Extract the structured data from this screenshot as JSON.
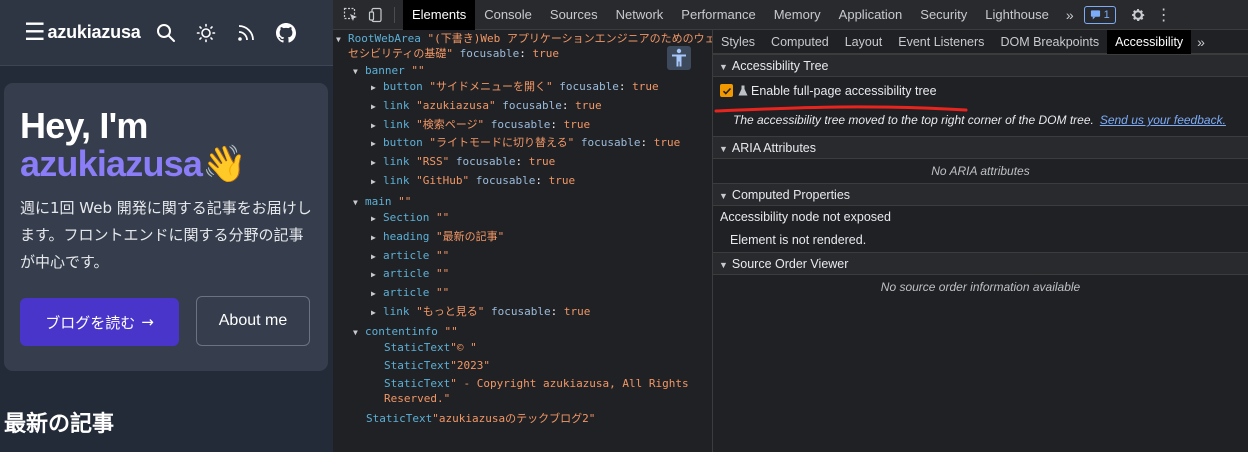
{
  "site": {
    "header": {
      "menu_glyph": "☰",
      "name": "azukiazusa",
      "icons": [
        "search-icon",
        "sun-icon",
        "rss-icon",
        "github-icon"
      ]
    },
    "hero": {
      "title_line1": "Hey, I'm",
      "title_name": "azukiazusa",
      "title_emoji": "👋",
      "description": "週に1回 Web 開発に関する記事をお届けします。フロントエンドに関する分野の記事が中心です。",
      "primary_button": "ブログを読む",
      "primary_button_arrow": "→",
      "secondary_button": "About me"
    },
    "latest_heading": "最新の記事"
  },
  "devtools": {
    "main_tabs": [
      "Elements",
      "Console",
      "Sources",
      "Network",
      "Performance",
      "Memory",
      "Application",
      "Security",
      "Lighthouse"
    ],
    "active_main_tab": "Elements",
    "more_tabs_glyph": "»",
    "issues_count": "1",
    "menu_glyph": "⋮",
    "tree": {
      "root": {
        "role": "RootWebArea",
        "name_line1": "\"(下書き)Web アプリケーションエンジニアのためのウェブアク",
        "name_line2": "セシビリティの基礎\"",
        "attr": "focusable",
        "value": "true"
      },
      "banner": {
        "role": "banner",
        "name": "\"\""
      },
      "banner_children": [
        {
          "role": "button",
          "name": "\"サイドメニューを開く\"",
          "attr": "focusable",
          "value": "true"
        },
        {
          "role": "link",
          "name": "\"azukiazusa\"",
          "attr": "focusable",
          "value": "true"
        },
        {
          "role": "link",
          "name": "\"検索ページ\"",
          "attr": "focusable",
          "value": "true"
        },
        {
          "role": "button",
          "name": "\"ライトモードに切り替える\"",
          "attr": "focusable",
          "value": "true"
        },
        {
          "role": "link",
          "name": "\"RSS\"",
          "attr": "focusable",
          "value": "true"
        },
        {
          "role": "link",
          "name": "\"GitHub\"",
          "attr": "focusable",
          "value": "true"
        }
      ],
      "main": {
        "role": "main",
        "name": "\"\""
      },
      "main_children": [
        {
          "role": "Section",
          "name": "\"\"",
          "attr": "",
          "value": ""
        },
        {
          "role": "heading",
          "name": "\"最新の記事\"",
          "attr": "",
          "value": ""
        },
        {
          "role": "article",
          "name": "\"\"",
          "attr": "",
          "value": ""
        },
        {
          "role": "article",
          "name": "\"\"",
          "attr": "",
          "value": ""
        },
        {
          "role": "article",
          "name": "\"\"",
          "attr": "",
          "value": ""
        },
        {
          "role": "link",
          "name": "\"もっと見る\"",
          "attr": "focusable",
          "value": "true"
        }
      ],
      "contentinfo": {
        "role": "contentinfo",
        "name": "\"\""
      },
      "contentinfo_children": [
        {
          "role": "StaticText",
          "name": "\"© \""
        },
        {
          "role": "StaticText",
          "name": "\"2023\""
        },
        {
          "role": "StaticText",
          "name_line1": "\" - Copyright azukiazusa, All Rights",
          "name_line2": "Reserved.\""
        }
      ],
      "trailing": {
        "role": "StaticText",
        "name": "\"azukiazusaのテックブログ2\""
      }
    },
    "side_tabs": [
      "Styles",
      "Computed",
      "Layout",
      "Event Listeners",
      "DOM Breakpoints",
      "Accessibility"
    ],
    "active_side_tab": "Accessibility",
    "sections": {
      "a11y_tree": {
        "title": "Accessibility Tree",
        "checkbox_label": "Enable full-page accessibility tree",
        "checked": true,
        "note": "The accessibility tree moved to the top right corner of the DOM tree.",
        "feedback_link": "Send us your feedback."
      },
      "aria": {
        "title": "ARIA Attributes",
        "empty": "No ARIA attributes"
      },
      "computed": {
        "title": "Computed Properties",
        "line1": "Accessibility node not exposed",
        "line2": "Element is not rendered."
      },
      "source_order": {
        "title": "Source Order Viewer",
        "empty": "No source order information available"
      }
    },
    "annotation_color": "#e8241f",
    "accent_color": "#f29900"
  }
}
